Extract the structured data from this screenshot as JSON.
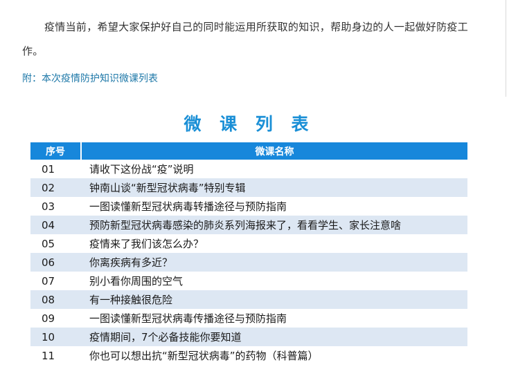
{
  "intro": {
    "paragraph": "疫情当前，希望大家保护好自己的同时能运用所获取的知识，帮助身边的人一起做好防疫工作。",
    "appendix_link": "附：本次疫情防护知识微课列表"
  },
  "table": {
    "title": "微 课 列 表",
    "header_number": "序号",
    "header_name": "微课名称",
    "rows": [
      {
        "number": "01",
        "name": "请收下这份战“疫”说明"
      },
      {
        "number": "02",
        "name": "钟南山谈“新型冠状病毒”特别专辑"
      },
      {
        "number": "03",
        "name": "一图读懂新型冠状病毒转播途径与预防指南"
      },
      {
        "number": "04",
        "name": "预防新型冠状病毒感染的肺炎系列海报来了，看看学生、家长注意啥"
      },
      {
        "number": "05",
        "name": "疫情来了我们该怎么办？"
      },
      {
        "number": "06",
        "name": "你离疾病有多近？"
      },
      {
        "number": "07",
        "name": "别小看你周围的空气"
      },
      {
        "number": "08",
        "name": "有一种接触很危险"
      },
      {
        "number": "09",
        "name": "一图读懂新型冠状病毒传播途径与预防指南"
      },
      {
        "number": "10",
        "name": "疫情期间，7个必备技能你要知道"
      },
      {
        "number": "11",
        "name": "你也可以想出抗“新型冠状病毒”的药物（科普篇）"
      }
    ]
  },
  "colors": {
    "header_bg": "#1787db",
    "title": "#1a8fd6",
    "stripe": "#dde7f3",
    "link": "#1e78a8"
  }
}
